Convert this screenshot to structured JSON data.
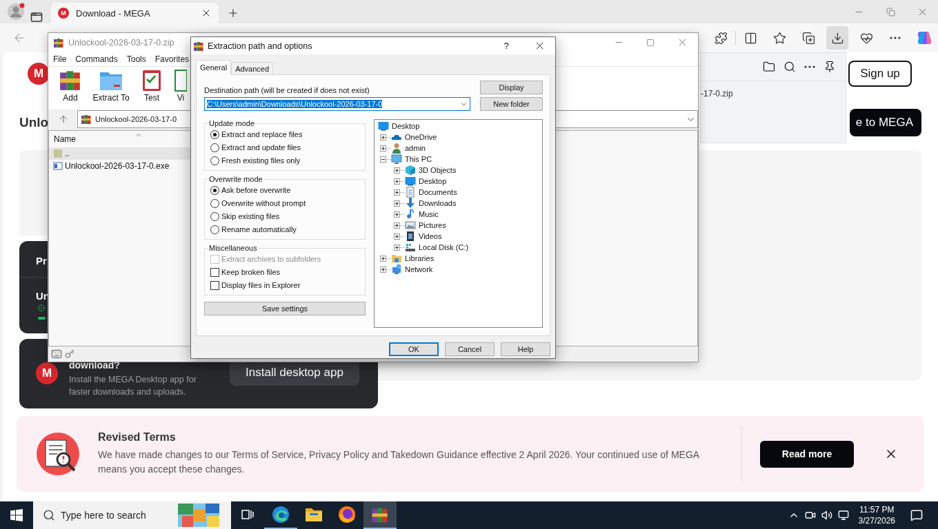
{
  "browser": {
    "tabs": [
      {
        "favicon": "M",
        "title": "Download - MEGA",
        "selected": true
      }
    ],
    "toolbar_buttons": [
      {
        "kind": "extensions",
        "selected": false
      },
      {
        "kind": "split",
        "selected": false
      },
      {
        "kind": "favorites",
        "selected": false
      },
      {
        "kind": "collections",
        "selected": false
      },
      {
        "kind": "downloads",
        "selected": true
      },
      {
        "kind": "health",
        "selected": false
      },
      {
        "kind": "more",
        "selected": false
      },
      {
        "kind": "copilot",
        "selected": false
      }
    ],
    "downloads_panel": {
      "file_name": "-17-0.zip"
    }
  },
  "page": {
    "logo": "M",
    "sign_up": "Sign up",
    "heading": "Unlo",
    "join_button": "e to MEGA",
    "progress_card": {
      "title": "Pr",
      "file": "Un"
    },
    "app_card": {
      "logo": "M",
      "title": "download?",
      "text": "Install the MEGA Desktop app for faster downloads and uploads.",
      "button": "Install desktop app"
    },
    "banner": {
      "title": "Revised Terms",
      "text": "We have made changes to our Terms of Service, Privacy Policy and Takedown Guidance effective 2 April 2026. Your continued use of MEGA means you accept these changes.",
      "button": "Read more"
    }
  },
  "winrar": {
    "title": "Unlockool-2026-03-17-0.zip",
    "menu": [
      "File",
      "Commands",
      "Tools",
      "Favorites"
    ],
    "toolbar": [
      {
        "kind": "add",
        "label": "Add"
      },
      {
        "kind": "extract",
        "label": "Extract To"
      },
      {
        "kind": "test",
        "label": "Test"
      },
      {
        "kind": "view",
        "label": "Vi"
      }
    ],
    "path": "Unlockool-2026-03-17-0",
    "name_column": "Name",
    "rows": [
      {
        "kind": "parent",
        "name": "..",
        "selected": true
      },
      {
        "kind": "exe",
        "name": "Unlockool-2026-03-17-0.exe",
        "selected": false
      }
    ]
  },
  "dialog": {
    "title": "Extraction path and options",
    "help": "?",
    "tabs": [
      {
        "label": "General",
        "selected": true
      },
      {
        "label": "Advanced",
        "selected": false
      }
    ],
    "destination_label": "Destination path (will be created if does not exist)",
    "destination": "C:\\Users\\admin\\Downloads\\Unlockool-2026-03-17-0",
    "side_buttons": [
      "Display",
      "New folder"
    ],
    "groups": [
      {
        "title": "Update mode",
        "options": [
          {
            "kind": "radio",
            "label": "Extract and replace files",
            "selected": true
          },
          {
            "kind": "radio",
            "label": "Extract and update files",
            "selected": false
          },
          {
            "kind": "radio",
            "label": "Fresh existing files only",
            "selected": false
          }
        ]
      },
      {
        "title": "Overwrite mode",
        "options": [
          {
            "kind": "radio",
            "label": "Ask before overwrite",
            "selected": true
          },
          {
            "kind": "radio",
            "label": "Overwrite without prompt",
            "selected": false
          },
          {
            "kind": "radio",
            "label": "Skip existing files",
            "selected": false
          },
          {
            "kind": "radio",
            "label": "Rename automatically",
            "selected": false
          }
        ]
      },
      {
        "title": "Miscellaneous",
        "options": [
          {
            "kind": "checkbox",
            "label": "Extract archives to subfolders",
            "checked": false,
            "disabled": true
          },
          {
            "kind": "checkbox",
            "label": "Keep broken files",
            "checked": false,
            "disabled": false
          },
          {
            "kind": "checkbox",
            "label": "Display files in Explorer",
            "checked": false,
            "disabled": false
          }
        ]
      }
    ],
    "save_button": "Save settings",
    "tree": {
      "label": "Desktop",
      "kind": "desktop",
      "children": [
        {
          "label": "OneDrive",
          "kind": "cloud",
          "expanded": false
        },
        {
          "label": "admin",
          "kind": "user",
          "expanded": false
        },
        {
          "label": "This PC",
          "kind": "computer",
          "expanded": true,
          "children": [
            {
              "label": "3D Objects",
              "kind": "cube",
              "expanded": false
            },
            {
              "label": "Desktop",
              "kind": "desktop",
              "expanded": false
            },
            {
              "label": "Documents",
              "kind": "documents",
              "expanded": false
            },
            {
              "label": "Downloads",
              "kind": "downloads",
              "expanded": false
            },
            {
              "label": "Music",
              "kind": "music",
              "expanded": false
            },
            {
              "label": "Pictures",
              "kind": "pictures",
              "expanded": false
            },
            {
              "label": "Videos",
              "kind": "videos",
              "expanded": false
            },
            {
              "label": "Local Disk (C:)",
              "kind": "disk",
              "expanded": false
            }
          ]
        },
        {
          "label": "Libraries",
          "kind": "library",
          "expanded": false
        },
        {
          "label": "Network",
          "kind": "network",
          "expanded": false
        }
      ]
    },
    "buttons": [
      {
        "label": "OK",
        "default": true
      },
      {
        "label": "Cancel",
        "default": false
      },
      {
        "label": "Help",
        "default": false
      }
    ]
  },
  "taskbar": {
    "search_placeholder": "Type here to search",
    "apps": [
      {
        "kind": "task-view",
        "running": false,
        "selected": false
      },
      {
        "kind": "edge",
        "running": true,
        "selected": false
      },
      {
        "kind": "explorer",
        "running": false,
        "selected": false
      },
      {
        "kind": "firefox",
        "running": false,
        "selected": false
      },
      {
        "kind": "winrar",
        "running": true,
        "selected": true
      }
    ],
    "time": "11:57 PM",
    "date": "3/27/2026"
  }
}
